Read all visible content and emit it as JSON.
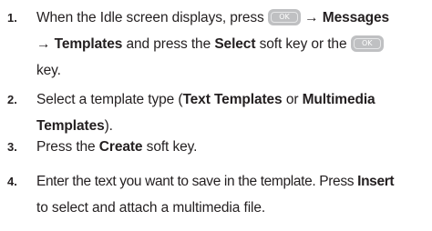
{
  "ok_key_label": "OK",
  "arrow": "→",
  "steps": [
    {
      "number": "1.",
      "l1_a": "When the Idle screen displays, press",
      "l1_b": "Messages",
      "l2_b1": "Templates",
      "l2_t1": "and press the",
      "l2_b2": "Select",
      "l2_t2": "soft key or the",
      "l3": "key."
    },
    {
      "number": "2.",
      "l1_a": "Select a template type (",
      "l1_b1": "Text Templates",
      "l1_c": "or",
      "l1_b2": "Multimedia",
      "l2_b": "Templates",
      "l2_c": ")."
    },
    {
      "number": "3.",
      "l1_a": "Press the",
      "l1_b": "Create",
      "l1_c": "soft key."
    },
    {
      "number": "4.",
      "l1_a": "Enter the text you want to save in the template. Press",
      "l1_b": "Insert",
      "l2": "to select and attach a multimedia file."
    }
  ]
}
